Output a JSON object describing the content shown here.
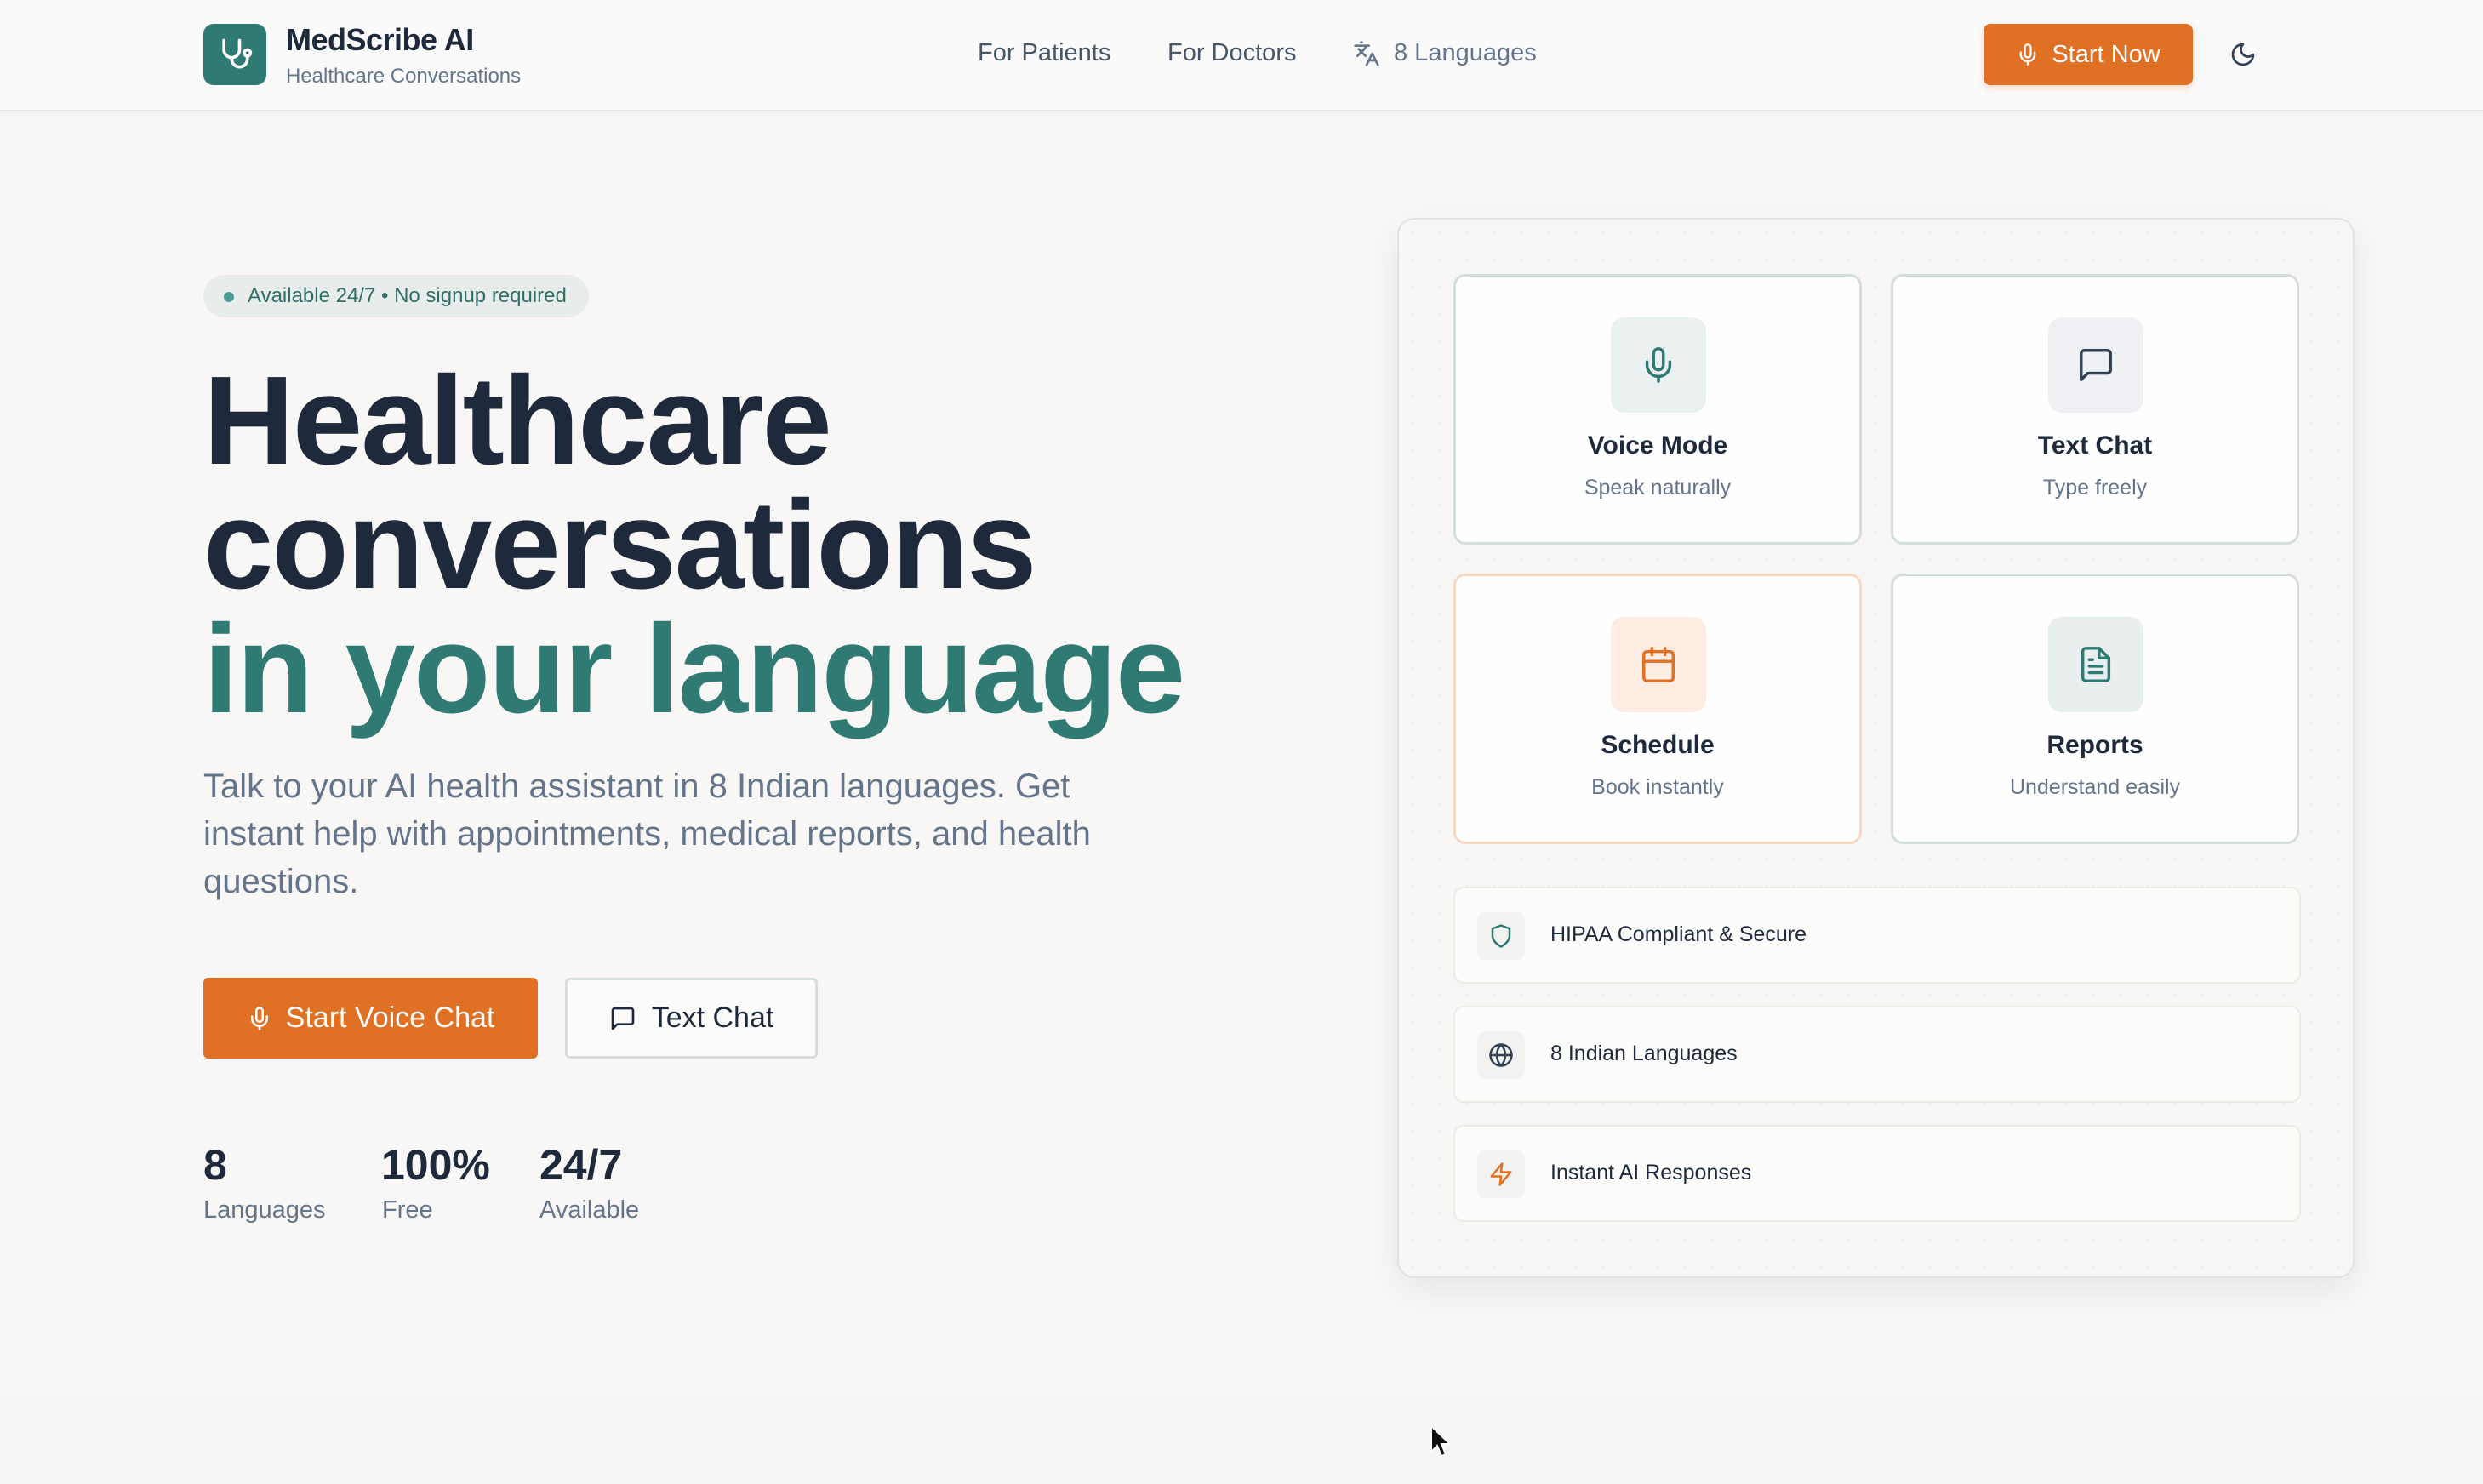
{
  "header": {
    "brand_name": "MedScribe AI",
    "brand_tagline": "Healthcare Conversations",
    "nav": {
      "patients": "For Patients",
      "doctors": "For Doctors",
      "languages": "8 Languages"
    },
    "cta": "Start Now"
  },
  "hero": {
    "badge": "Available 24/7 • No signup required",
    "title_line1": "Healthcare",
    "title_line2": "conversations",
    "title_line3": "in your language",
    "description": "Talk to your AI health assistant in 8 Indian languages. Get instant help with appointments, medical reports, and health questions.",
    "primary_button": "Start Voice Chat",
    "secondary_button": "Text Chat",
    "stats": [
      {
        "value": "8",
        "label": "Languages"
      },
      {
        "value": "100%",
        "label": "Free"
      },
      {
        "value": "24/7",
        "label": "Available"
      }
    ]
  },
  "panel": {
    "cards": [
      {
        "title": "Voice Mode",
        "subtitle": "Speak naturally",
        "icon": "mic-icon"
      },
      {
        "title": "Text Chat",
        "subtitle": "Type freely",
        "icon": "message-square-icon"
      },
      {
        "title": "Schedule",
        "subtitle": "Book instantly",
        "icon": "calendar-icon"
      },
      {
        "title": "Reports",
        "subtitle": "Understand easily",
        "icon": "file-text-icon"
      }
    ],
    "features": [
      {
        "label": "HIPAA Compliant & Secure",
        "icon": "shield-icon"
      },
      {
        "label": "8 Indian Languages",
        "icon": "globe-icon"
      },
      {
        "label": "Instant AI Responses",
        "icon": "zap-icon"
      }
    ]
  },
  "colors": {
    "primary_teal": "#2f7a72",
    "accent_orange": "#e07024",
    "text_dark": "#1e293b",
    "text_muted": "#64748b",
    "background": "#f8f7f5"
  }
}
